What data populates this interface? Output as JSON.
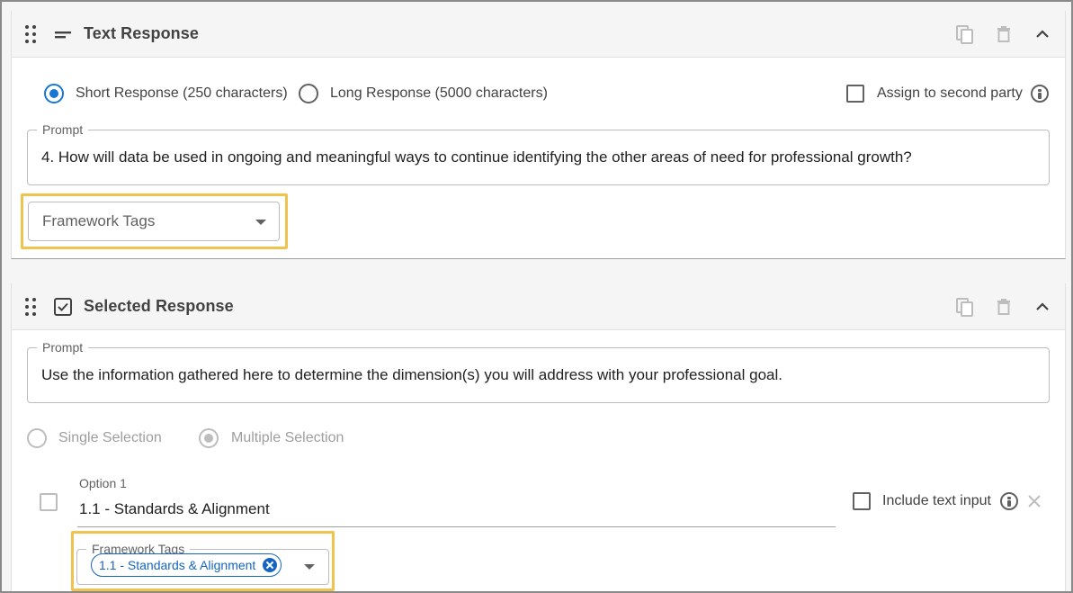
{
  "text_response": {
    "title": "Text Response",
    "icon": "short-text-icon",
    "options": {
      "short_label": "Short Response (250 characters)",
      "long_label": "Long Response (5000 characters)",
      "selected": "short"
    },
    "assign_label": "Assign to second party",
    "prompt": {
      "label": "Prompt",
      "value": "4.  How will data be used in ongoing and meaningful ways to continue identifying the other areas of need for professional growth?"
    },
    "framework_tags_placeholder": "Framework Tags"
  },
  "selected_response": {
    "title": "Selected Response",
    "icon": "checkbox-icon",
    "prompt": {
      "label": "Prompt",
      "value": "Use the information gathered here to determine the dimension(s) you will address with your professional goal."
    },
    "selection_modes": {
      "single_label": "Single Selection",
      "multiple_label": "Multiple Selection",
      "selected": "multiple"
    },
    "option1": {
      "label": "Option 1",
      "value": "1.1 - Standards & Alignment",
      "include_text_label": "Include text input"
    },
    "option_framework_tags": {
      "label": "Framework Tags",
      "chips": [
        "1.1 - Standards & Alignment"
      ]
    }
  },
  "colors": {
    "accent": "#1976d2",
    "highlight": "#f0c24e",
    "chip": "#1565c0"
  }
}
